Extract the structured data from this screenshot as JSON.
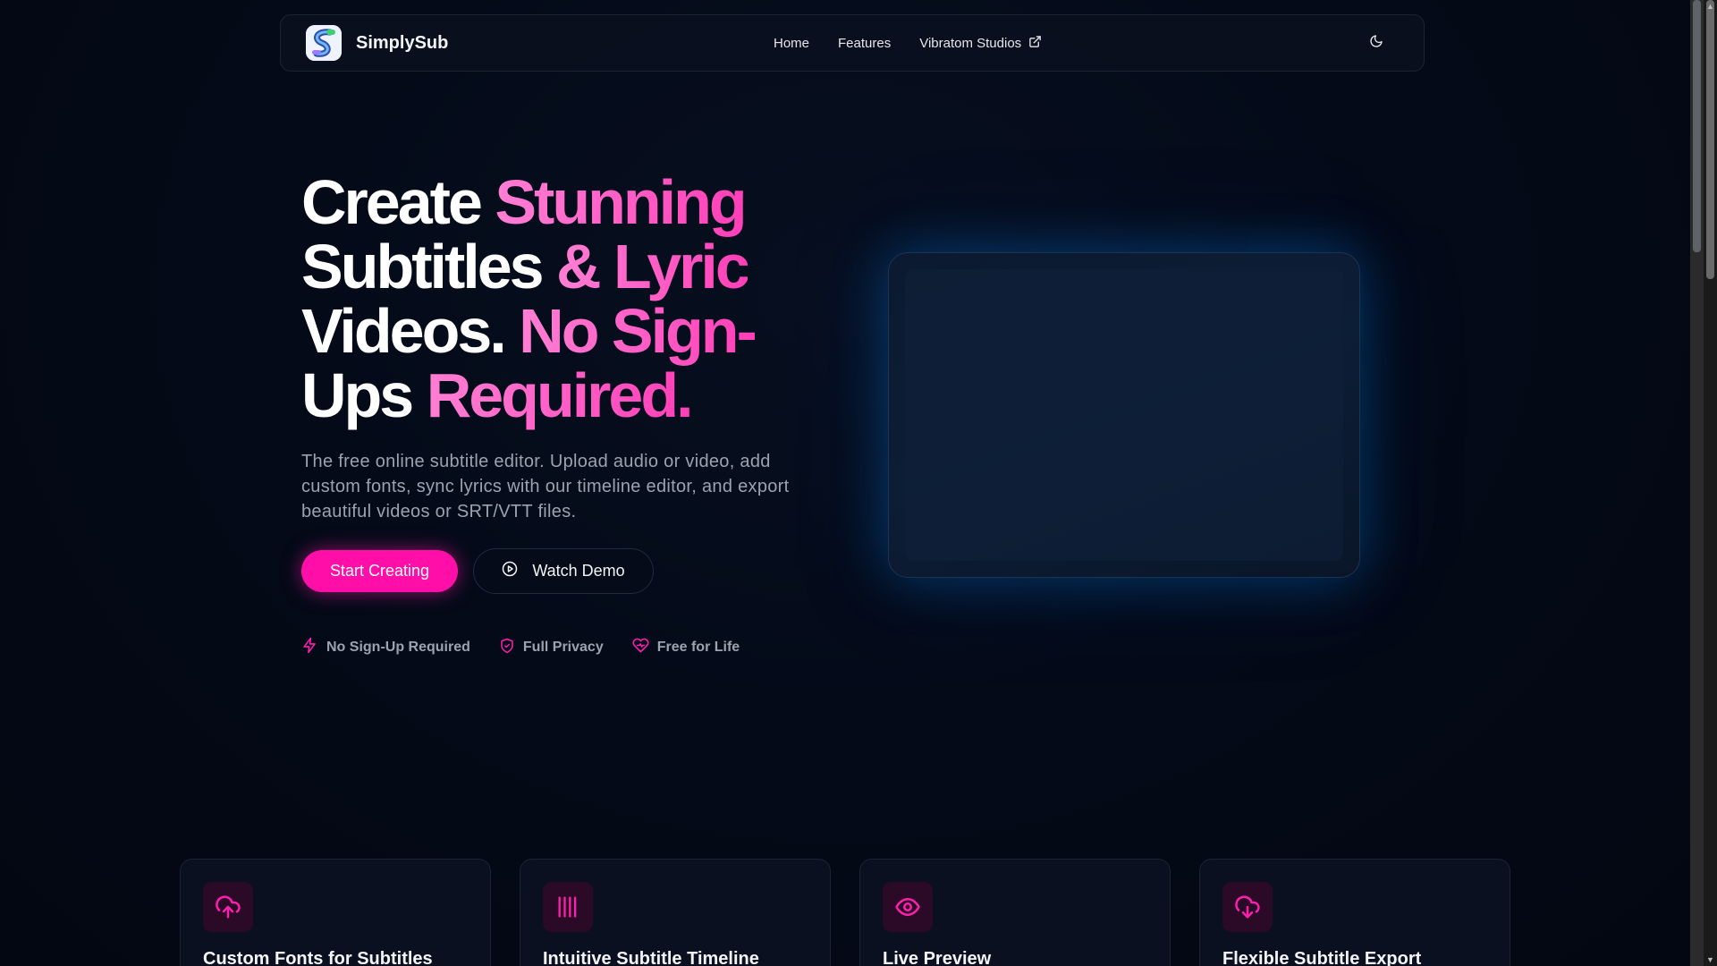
{
  "nav": {
    "brand": "SimplySub",
    "links": [
      {
        "label": "Home"
      },
      {
        "label": "Features"
      },
      {
        "label": "Vibratom Studios"
      }
    ]
  },
  "hero": {
    "headline": {
      "line1_white": "Create ",
      "line1_pink": "Stunning",
      "line2_white": "Subtitles ",
      "line2_pink": "& Lyric",
      "line3_white": "Videos. ",
      "line3_pink": "No Sign-",
      "line4_white": "Ups ",
      "line4_pink": "Required."
    },
    "subtitle": "The free online subtitle editor. Upload audio or video, add custom fonts, sync lyrics with our timeline editor, and export beautiful videos or SRT/VTT files.",
    "primary_button": "Start Creating",
    "secondary_button": "Watch Demo",
    "badges": [
      {
        "label": "No Sign-Up Required",
        "icon": "lightning-icon"
      },
      {
        "label": "Full Privacy",
        "icon": "shield-icon"
      },
      {
        "label": "Free for Life",
        "icon": "heart-icon"
      }
    ]
  },
  "features": [
    {
      "title": "Custom Fonts for Subtitles",
      "icon": "cloud-upload-icon"
    },
    {
      "title": "Intuitive Subtitle Timeline",
      "icon": "timeline-bars-icon"
    },
    {
      "title": "Live Preview",
      "icon": "eye-icon"
    },
    {
      "title": "Flexible Subtitle Export",
      "icon": "cloud-download-icon"
    }
  ],
  "colors": {
    "accent": "#ff0fa8",
    "background": "#030712",
    "glow": "#008cff"
  }
}
